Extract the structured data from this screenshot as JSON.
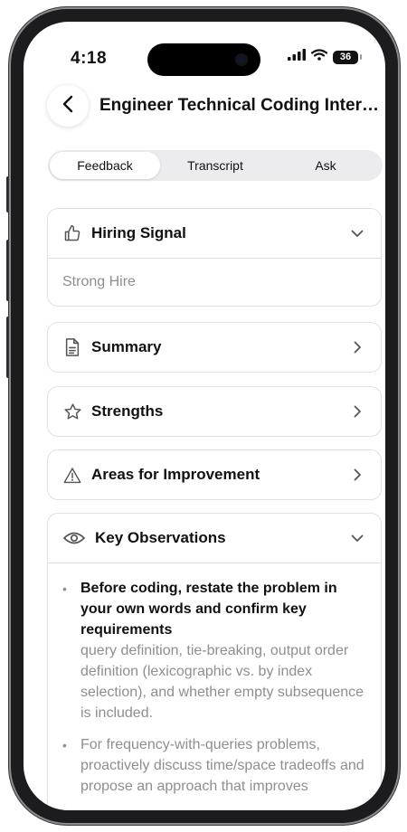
{
  "status_bar": {
    "time": "4:18",
    "battery": "36"
  },
  "header": {
    "title": "Engineer Technical Coding Interview..."
  },
  "tabs": [
    {
      "label": "Feedback",
      "active": true
    },
    {
      "label": "Transcript",
      "active": false
    },
    {
      "label": "Ask",
      "active": false
    }
  ],
  "hiring_signal": {
    "label": "Hiring Signal",
    "value": "Strong Hire",
    "icon": "thumbs-up-icon",
    "expanded": true
  },
  "summary": {
    "label": "Summary",
    "icon": "document-icon"
  },
  "strengths": {
    "label": "Strengths",
    "icon": "star-icon"
  },
  "improvement": {
    "label": "Areas for Improvement",
    "icon": "warning-icon"
  },
  "observations": {
    "label": "Key Observations",
    "icon": "eye-icon",
    "expanded": true,
    "items": [
      {
        "title": "Before coding, restate the problem in your own words and confirm key requirements",
        "desc": "query definition, tie-breaking, output order definition (lexicographic vs. by index selection), and whether empty subsequence is included."
      },
      {
        "title": "",
        "desc": "For frequency-with-queries problems, proactively discuss time/space tradeoffs and propose an approach that improves"
      }
    ]
  },
  "colors": {
    "text": "#111111",
    "muted": "#8e8e93",
    "border": "#e0e0e3",
    "segment_bg": "#ececee"
  }
}
